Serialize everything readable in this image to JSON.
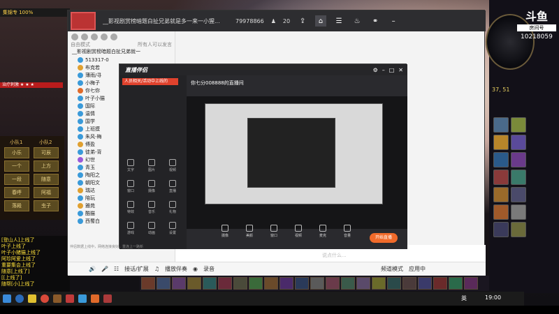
{
  "game": {
    "topbar": "集锦专 100%",
    "hp_bar": "治疗刺激 ★ ★ ★",
    "party": {
      "col1_title": "小队1",
      "col2_title": "小队2",
      "col1": [
        "小乐",
        "一个",
        "一段",
        "春呼",
        "落殿"
      ],
      "col2": [
        "可辰",
        "上方",
        "随意",
        "阿福",
        "虫子"
      ]
    },
    "log_lines": [
      "[登山人]上线了",
      "叶子上线了",
      "叶子小猪猫上线了",
      "阿珍阿爱上线了",
      "重要集会上线了",
      "随意[上线了]",
      "[[上线了]",
      "随帮[小]上线了",
      "陈晨蜂蜜[线了]"
    ],
    "room_label": "房间号",
    "room_number": "10218059",
    "coords": "37, 51"
  },
  "chat": {
    "title": "__影视剧赏榜暗题白扯兄弟就是多一来一小猩...",
    "member_count": "79978866",
    "online": "20",
    "list_header_left": "自由模式",
    "list_header_right": "所有人可以发言",
    "group_title": "__影视剧赏榜暗题白扯兄弟就一",
    "members": [
      "513317-0",
      "布克若",
      "薄雨/寻",
      "小梅子",
      "你七你",
      "叶子小猫",
      "国际",
      "温情",
      "国学",
      "上班摸",
      "朱风-梅",
      "傅盈",
      "徒弟-背",
      "幻世",
      "青玉",
      "陶阳之",
      "朝阳文",
      "瑞达",
      "陪玩",
      "雅苑",
      "酷猫",
      "西蜀白"
    ],
    "input_placeholder": "说点什么...",
    "bottom": {
      "voice": "接话/扩展",
      "music": "播放伴奏",
      "record": "录音",
      "mode": "频道模式",
      "app": "应用中"
    }
  },
  "assist": {
    "title": "直播伴侣",
    "tab": "人员相关/活动中上线的",
    "stream_name": "你七分008888的直播间",
    "start_label": "开始直播",
    "status": "伴侣数据上线中，网络连接良好，重连上一路新",
    "side_buttons": [
      "文字",
      "图片",
      "视频",
      "窗口",
      "摄像",
      "直播",
      "特效",
      "音乐",
      "礼物",
      "游戏",
      "动画",
      "设置"
    ],
    "tools": [
      "摄像",
      "美颜",
      "窗口",
      "视频",
      "麦克",
      "音量"
    ]
  },
  "taskbar": {
    "ime": "英",
    "clock": "19:00"
  }
}
